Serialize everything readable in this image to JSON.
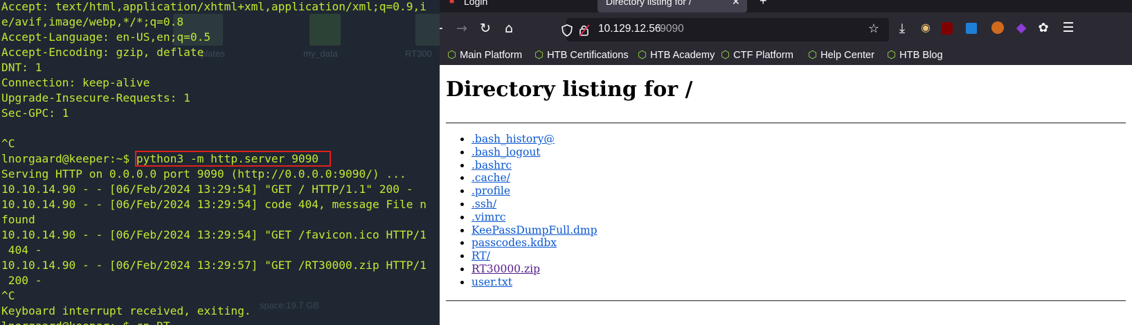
{
  "terminal": {
    "lines": [
      "Accept: text/html,application/xhtml+xml,application/xml;q=0.9,i",
      "e/avif,image/webp,*/*;q=0.8",
      "Accept-Language: en-US,en;q=0.5",
      "Accept-Encoding: gzip, deflate",
      "DNT: 1",
      "Connection: keep-alive",
      "Upgrade-Insecure-Requests: 1",
      "Sec-GPC: 1",
      "",
      "^C",
      "",
      "Serving HTTP on 0.0.0.0 port 9090 (http://0.0.0.0:9090/) ...",
      "10.10.14.90 - - [06/Feb/2024 13:29:54] \"GET / HTTP/1.1\" 200 -",
      "10.10.14.90 - - [06/Feb/2024 13:29:54] code 404, message File n",
      "found",
      "10.10.14.90 - - [06/Feb/2024 13:29:54] \"GET /favicon.ico HTTP/1",
      " 404 -",
      "10.10.14.90 - - [06/Feb/2024 13:29:57] \"GET /RT30000.zip HTTP/1",
      " 200 -",
      "^C",
      "Keyboard interrupt received, exiting.",
      "lnorgaard@keeper:~$ cp RT"
    ],
    "prompt": "lnorgaard@keeper:~$ ",
    "highlighted_command": "python3 -m http.server 9090",
    "desktop_labels": [
      "plates",
      "my_data",
      "RT300"
    ],
    "status_text": "space:19.7 GB"
  },
  "browser": {
    "tabs": [
      {
        "label": "Login"
      },
      {
        "label": "Directory listing for /"
      }
    ],
    "url": {
      "host": "10.129.12.56",
      "port": ":9090"
    },
    "bookmarks": [
      "Main Platform",
      "HTB Certifications",
      "HTB Academy",
      "CTF Platform",
      "Help Center",
      "HTB Blog"
    ],
    "page": {
      "title": "Directory listing for /",
      "files": [
        ".bash_history@",
        ".bash_logout",
        ".bashrc",
        ".cache/",
        ".profile",
        ".ssh/",
        ".vimrc",
        "KeePassDumpFull.dmp",
        "passcodes.kdbx",
        "RT/",
        "RT30000.zip",
        "user.txt"
      ],
      "visited_file": "RT30000.zip"
    },
    "icons": [
      "back-icon",
      "forward-icon",
      "reload-icon",
      "home-icon",
      "shield-icon",
      "lock-icon",
      "star-icon",
      "download-icon",
      "menu-icon"
    ],
    "colors": {
      "link": "#0b57d0",
      "visited": "#551a8b",
      "terminal_text": "#c4e832",
      "highlight_border": "#e0201c"
    }
  }
}
